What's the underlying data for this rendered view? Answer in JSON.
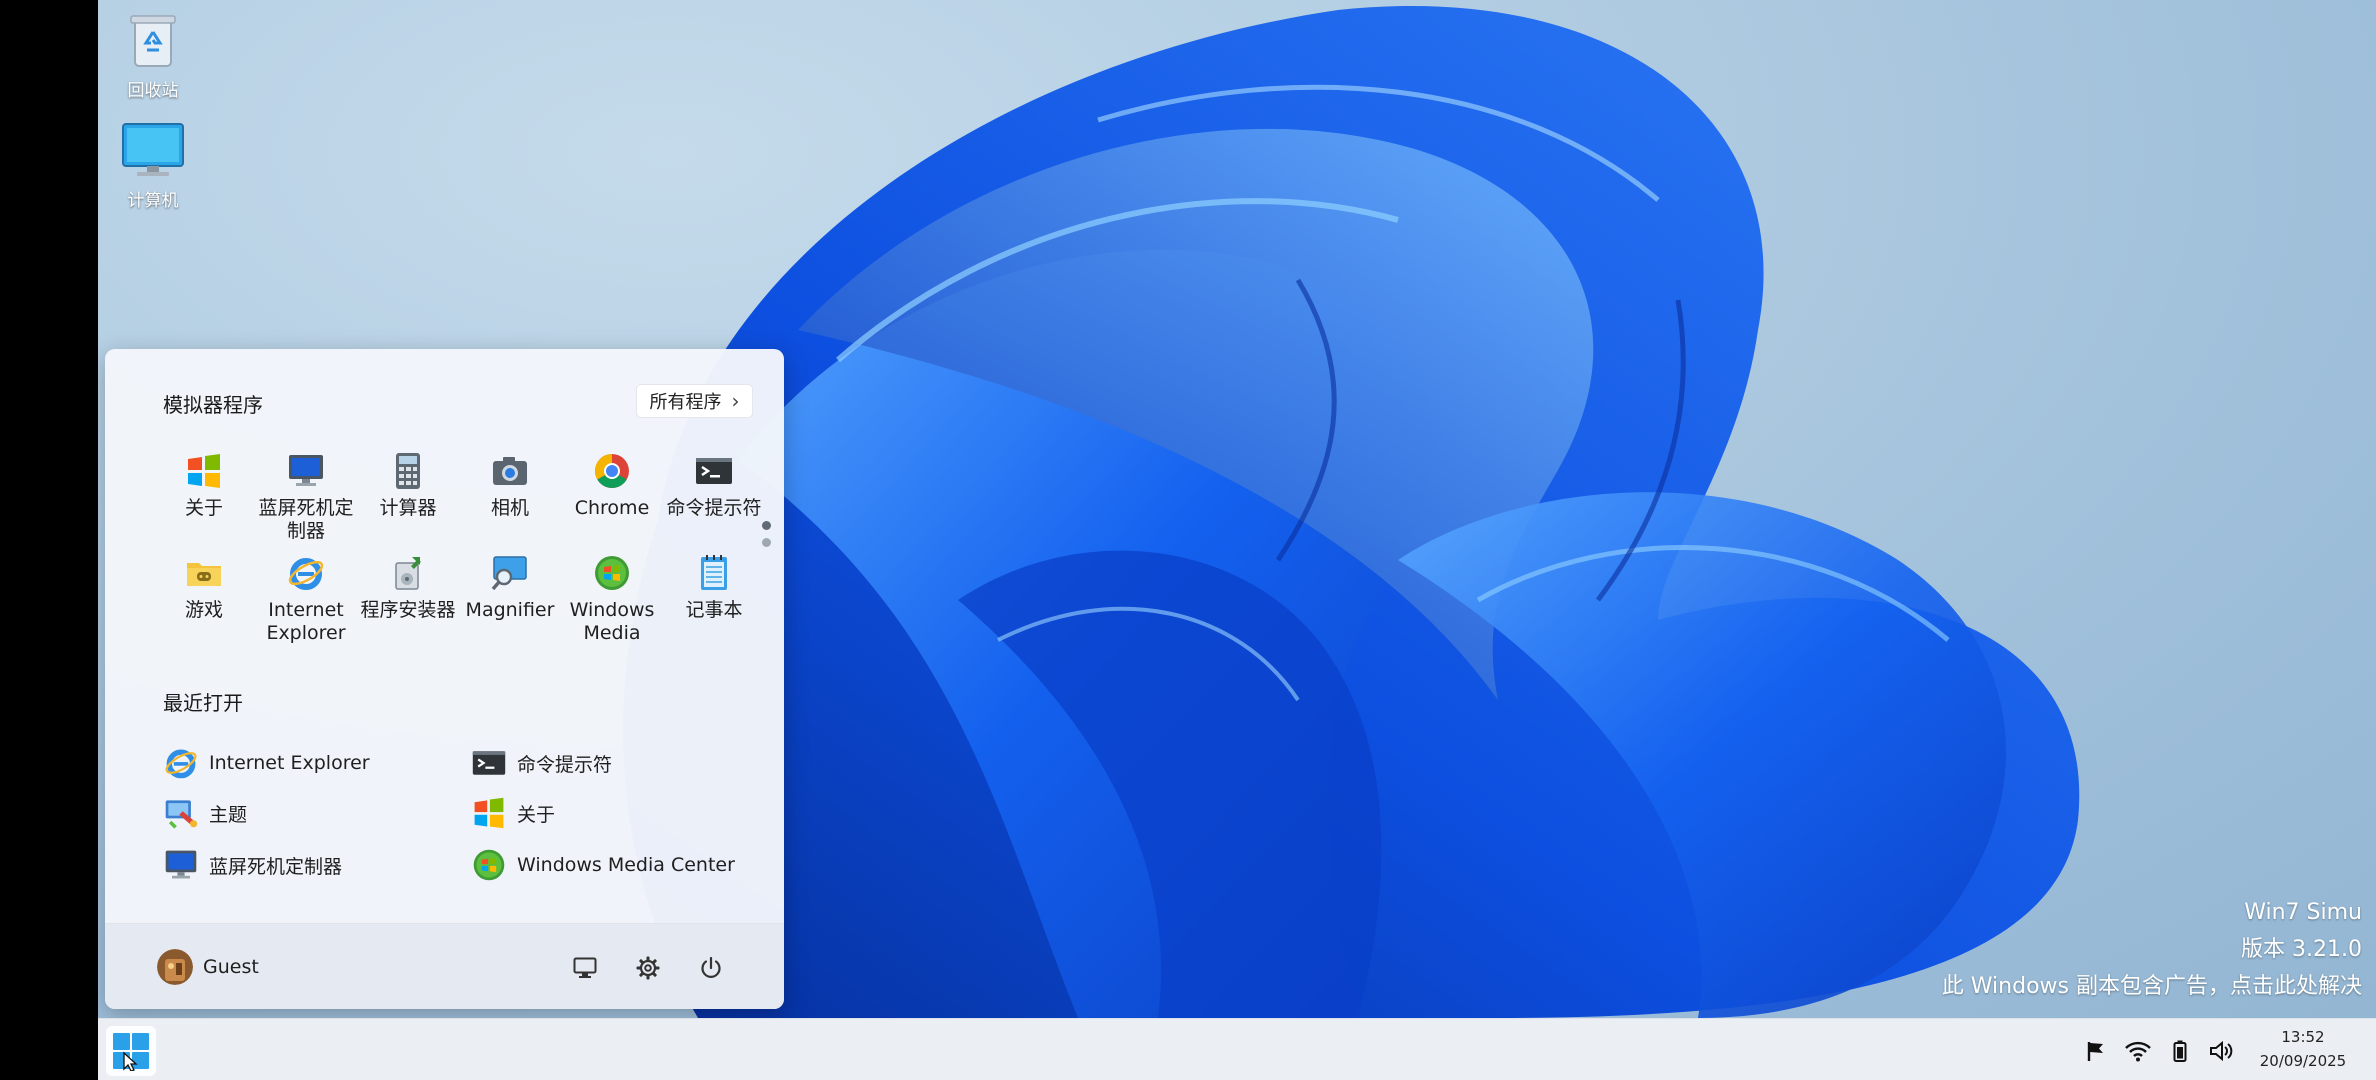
{
  "desktop": {
    "icons": [
      {
        "label": "回收站",
        "icon": "recycle-bin-icon"
      },
      {
        "label": "计算机",
        "icon": "computer-icon"
      }
    ],
    "watermark": {
      "line1": "Win7 Simu",
      "line2": "版本 3.21.0",
      "line3": "此 Windows 副本包含广告，点击此处解决"
    }
  },
  "start_menu": {
    "pinned_title": "模拟器程序",
    "all_programs_label": "所有程序",
    "pinned": [
      {
        "label": "关于",
        "icon": "windows-logo-icon"
      },
      {
        "label": "蓝屏死机定制器",
        "icon": "bsod-monitor-icon"
      },
      {
        "label": "计算器",
        "icon": "calculator-icon"
      },
      {
        "label": "相机",
        "icon": "camera-icon"
      },
      {
        "label": "Chrome",
        "icon": "chrome-icon"
      },
      {
        "label": "命令提示符",
        "icon": "command-prompt-icon"
      },
      {
        "label": "游戏",
        "icon": "games-folder-icon"
      },
      {
        "label": "Internet Explorer",
        "icon": "internet-explorer-icon"
      },
      {
        "label": "程序安装器",
        "icon": "installer-icon"
      },
      {
        "label": "Magnifier",
        "icon": "magnifier-icon"
      },
      {
        "label": "Windows Media Center",
        "icon": "media-center-icon"
      },
      {
        "label": "记事本",
        "icon": "notepad-icon"
      }
    ],
    "recent_title": "最近打开",
    "recent": [
      {
        "label": "Internet Explorer",
        "icon": "internet-explorer-icon"
      },
      {
        "label": "命令提示符",
        "icon": "command-prompt-icon"
      },
      {
        "label": "主题",
        "icon": "theme-icon"
      },
      {
        "label": "关于",
        "icon": "windows-logo-icon"
      },
      {
        "label": "蓝屏死机定制器",
        "icon": "bsod-monitor-icon"
      },
      {
        "label": "Windows Media Center",
        "icon": "media-center-icon"
      }
    ],
    "user": {
      "name": "Guest"
    }
  },
  "taskbar": {
    "time": "13:52",
    "date": "20/09/2025"
  },
  "colors": {
    "accent": "#1a73e8",
    "menu_bg": "#f3f6fb",
    "user_bar_bg": "#e4e9f1",
    "wallpaper_bloom": "#1a5ee8"
  }
}
